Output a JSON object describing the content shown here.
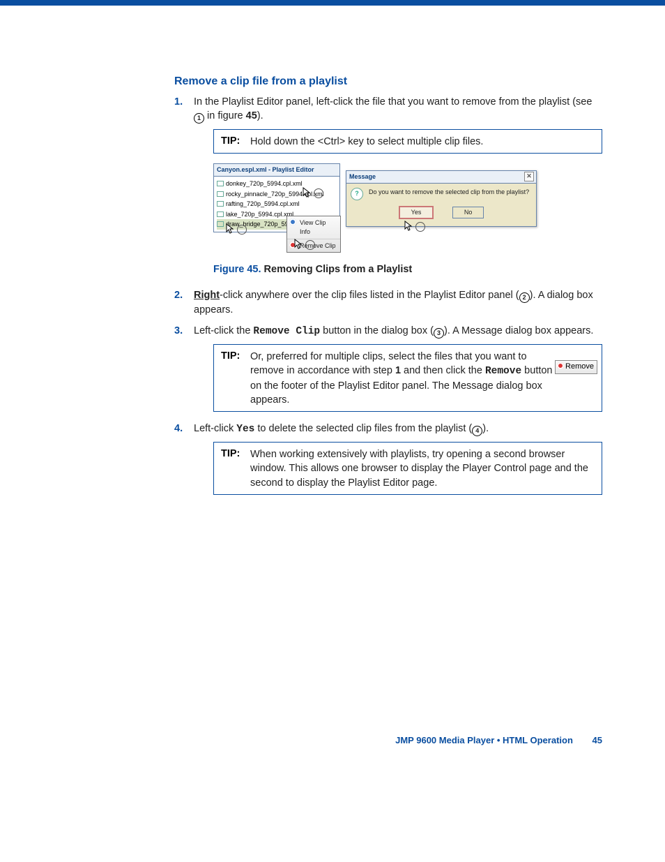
{
  "heading": "Remove a clip file from a playlist",
  "steps": {
    "s1a": "In the Playlist Editor panel, left-click the file that you want to remove from the playlist (see ",
    "s1b": " in figure ",
    "s1c": ").",
    "s2a": "-click anywhere over the clip files listed in the Playlist Editor panel (",
    "s2b": "). A dialog box appears.",
    "s2right": "Right",
    "s3a": "Left-click the ",
    "s3b": " button in the dialog box (",
    "s3c": "). A Message dialog box appears.",
    "s3btn": "Remove Clip",
    "s4a": "Left-click ",
    "s4b": " to delete the selected clip files from the playlist (",
    "s4c": ").",
    "s4btn": "Yes"
  },
  "nums": {
    "one": "1.",
    "two": "2.",
    "three": "3.",
    "four": "4.",
    "fig45": "45"
  },
  "circ": {
    "c1": "1",
    "c2": "2",
    "c3": "3",
    "c4": "4"
  },
  "tip1": {
    "label": "TIP:",
    "text": "Hold down the <Ctrl> key to select multiple clip files."
  },
  "tip2": {
    "label": "TIP:",
    "a": "Or, preferred for multiple clips, select the files that you want to remove in accordance with step ",
    "stepref": "1",
    "b": " and then click the ",
    "btn": "Remove",
    "c": " button on the footer of the Playlist Editor panel. The Message dialog box appears.",
    "removebtn": "Remove"
  },
  "tip3": {
    "label": "TIP:",
    "text": "When working extensively with playlists, try opening a second browser window. This allows one browser to display the Player Control page and the second to display the Playlist Editor page."
  },
  "figcaption": {
    "num": "Figure 45.",
    "text": " Removing Clips from a Playlist"
  },
  "panel": {
    "title": "Canyon.espl.xml - Playlist Editor",
    "items": [
      "donkey_720p_5994.cpl.xml",
      "rocky_pinnacle_720p_5994.cpl.xml",
      "rafting_720p_5994.cpl.xml",
      "lake_720p_5994.cpl.xml",
      "draw_bridge_720p_5994.cpl.xml"
    ]
  },
  "ctxmenu": {
    "view": "View Clip Info",
    "remove": "Remove Clip"
  },
  "dialog": {
    "title": "Message",
    "text": "Do you want to remove the selected clip from the playlist?",
    "yes": "Yes",
    "no": "No"
  },
  "footer": {
    "title": "JMP 9600 Media Player • HTML Operation",
    "page": "45"
  }
}
